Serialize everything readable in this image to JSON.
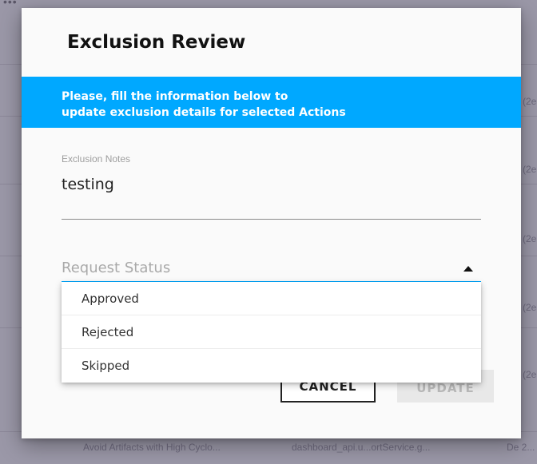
{
  "background": {
    "rows": [
      {
        "col1": "Avoid Artifacts with High Cyclo...",
        "col2": "dashboard_api.u...ortService.g...",
        "col3": "De 2..."
      }
    ],
    "right_edge_snippets": [
      "(2e",
      "(2e",
      "(2e",
      "(2e",
      "(2e",
      "(2e"
    ]
  },
  "dialog": {
    "title": "Exclusion Review",
    "banner": {
      "line1": "Please, fill the information below to",
      "line2": "update exclusion details for selected Actions"
    },
    "notes": {
      "label": "Exclusion Notes",
      "value": "testing"
    },
    "status": {
      "placeholder": "Request Status",
      "options": [
        "Approved",
        "Rejected",
        "Skipped"
      ]
    },
    "buttons": {
      "cancel": "CANCEL",
      "update": "UPDATE"
    }
  },
  "colors": {
    "accent": "#00a8ff",
    "overlay": "#9b98a8"
  }
}
